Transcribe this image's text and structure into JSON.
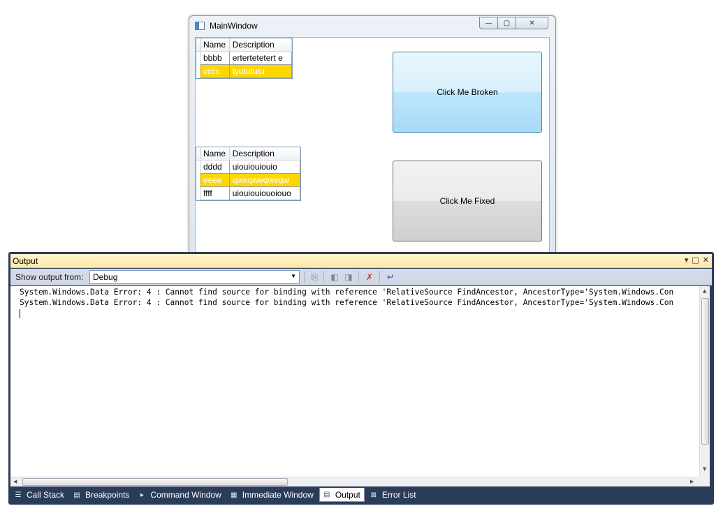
{
  "main_window": {
    "title": "MainWindow",
    "caption": {
      "minimize": "—",
      "maximize": "▢",
      "close": "✕"
    },
    "grid1": {
      "columns": [
        "Name",
        "Description"
      ],
      "rows": [
        {
          "name": "bbbb",
          "description": "ertertetetert e"
        },
        {
          "name": "cccc",
          "description": "tyutututu"
        }
      ],
      "selected_index": 1
    },
    "grid2": {
      "columns": [
        "Name",
        "Description"
      ],
      "rows": [
        {
          "name": "dddd",
          "description": "uiouiouiouio"
        },
        {
          "name": "eeee",
          "description": "qweqweqweqw"
        },
        {
          "name": "ffff",
          "description": "uiouiouiouoiouo"
        }
      ],
      "selected_index": 1
    },
    "button_broken": "Click Me Broken",
    "button_fixed": "Click Me Fixed",
    "colors": {
      "selection": "#ffd700"
    }
  },
  "output": {
    "title": "Output",
    "pane_controls": {
      "dropdown": "▾",
      "float": "□",
      "close": "✕"
    },
    "show_output_label": "Show output from:",
    "source": "Debug",
    "lines": [
      "System.Windows.Data Error: 4 : Cannot find source for binding with reference 'RelativeSource FindAncestor, AncestorType='System.Windows.Con",
      "System.Windows.Data Error: 4 : Cannot find source for binding with reference 'RelativeSource FindAncestor, AncestorType='System.Windows.Con"
    ],
    "icons": [
      "find-message-icon",
      "prev-message-icon",
      "next-message-icon",
      "clear-all-icon",
      "word-wrap-icon"
    ]
  },
  "tool_tabs": [
    {
      "label": "Call Stack",
      "icon": "call-stack-icon",
      "active": false
    },
    {
      "label": "Breakpoints",
      "icon": "breakpoints-icon",
      "active": false
    },
    {
      "label": "Command Window",
      "icon": "command-window-icon",
      "active": false
    },
    {
      "label": "Immediate Window",
      "icon": "immediate-window-icon",
      "active": false
    },
    {
      "label": "Output",
      "icon": "output-icon",
      "active": true
    },
    {
      "label": "Error List",
      "icon": "error-list-icon",
      "active": false
    }
  ]
}
